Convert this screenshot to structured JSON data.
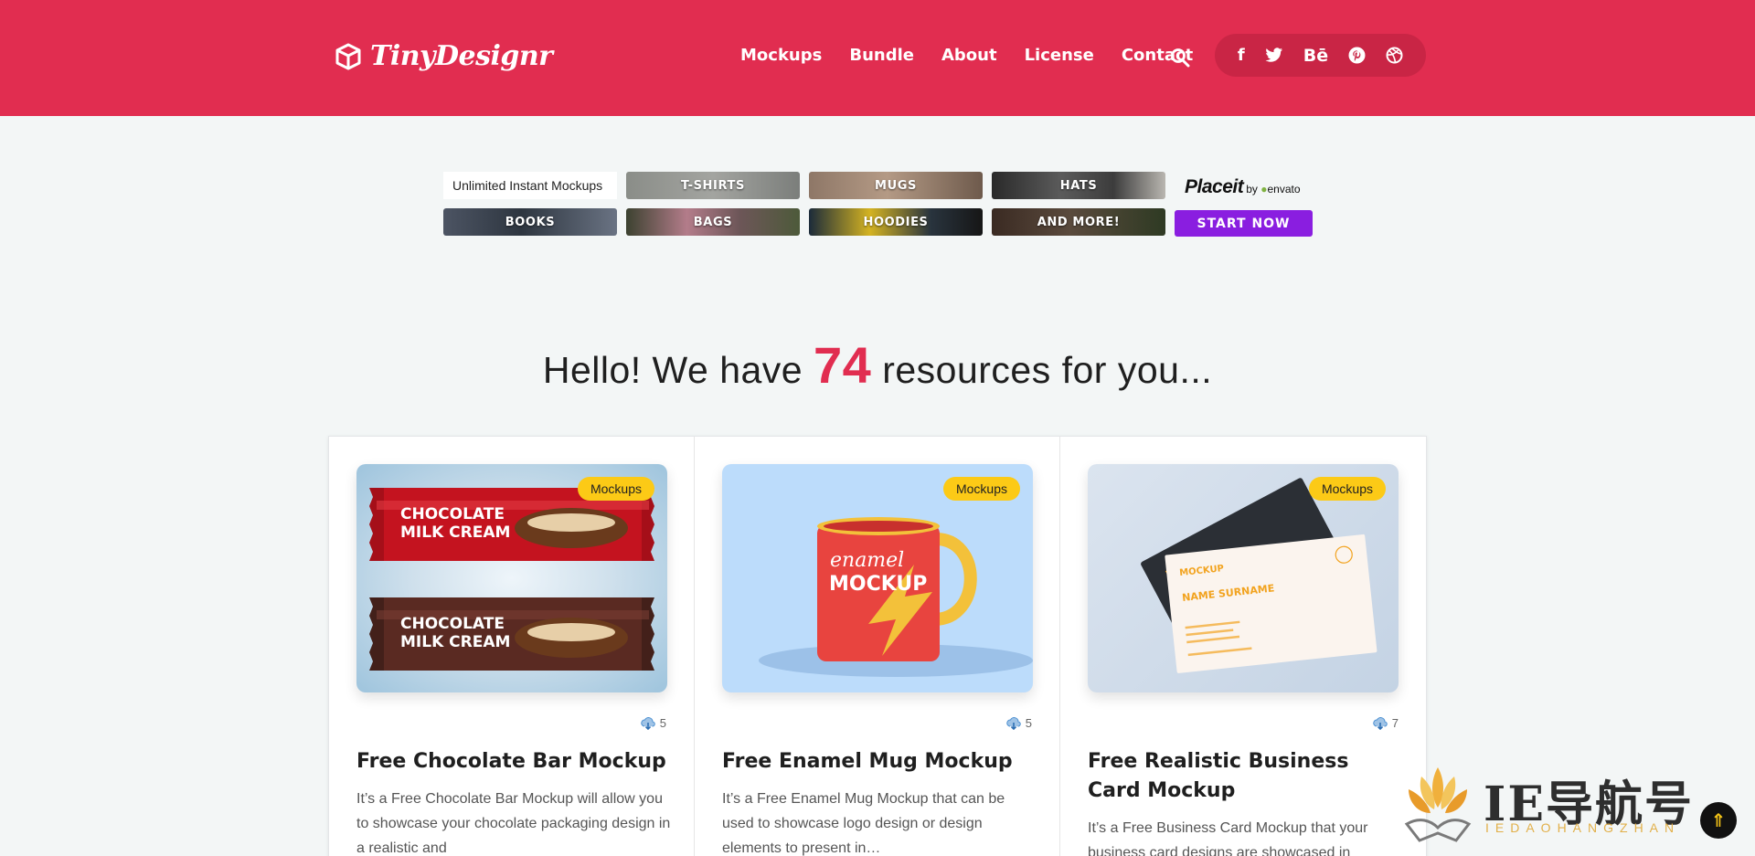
{
  "header": {
    "brand": "TinyDesignr",
    "nav": [
      "Mockups",
      "Bundle",
      "About",
      "License",
      "Contact"
    ],
    "social_icons": [
      "facebook-icon",
      "twitter-icon",
      "behance-icon",
      "pinterest-icon",
      "dribbble-icon"
    ],
    "accent_color": "#e12d50"
  },
  "promo": {
    "intro": "Unlimited Instant Mockups",
    "categories": [
      "T-SHIRTS",
      "MUGS",
      "HATS",
      "BOOKS",
      "BAGS",
      "HOODIES",
      "AND MORE!"
    ],
    "brand_main": "Placeit",
    "brand_by": "by",
    "brand_partner": "envato",
    "cta": "START NOW",
    "cta_color": "#8a1ee0"
  },
  "hero": {
    "before": "Hello! We have ",
    "count": "74",
    "after": " resources for you..."
  },
  "cards": [
    {
      "badge": "Mockups",
      "downloads": "5",
      "title": "Free Chocolate Bar Mockup",
      "desc": "It’s a Free Chocolate Bar Mockup will allow you to showcase your chocolate packaging design in a realistic and",
      "image_text": [
        "CHOCOLATE",
        "MILK CREAM",
        "CHOCOLATE",
        "MILK CREAM"
      ]
    },
    {
      "badge": "Mockups",
      "downloads": "5",
      "title": "Free Enamel Mug Mockup",
      "desc": "It’s a Free Enamel Mug Mockup that can be used to showcase logo design or design elements to present in…",
      "image_text": [
        "enamel",
        "MOCKUP"
      ]
    },
    {
      "badge": "Mockups",
      "downloads": "7",
      "title": "Free Realistic Business Card Mockup",
      "desc": "It’s a Free Business Card Mockup that your business card designs are showcased in",
      "image_text": [
        "MOCKUP",
        "NAME SURNAME"
      ]
    }
  ],
  "watermark": {
    "text": "IE导航号",
    "sub": "IEDAOHANGZHAN"
  }
}
